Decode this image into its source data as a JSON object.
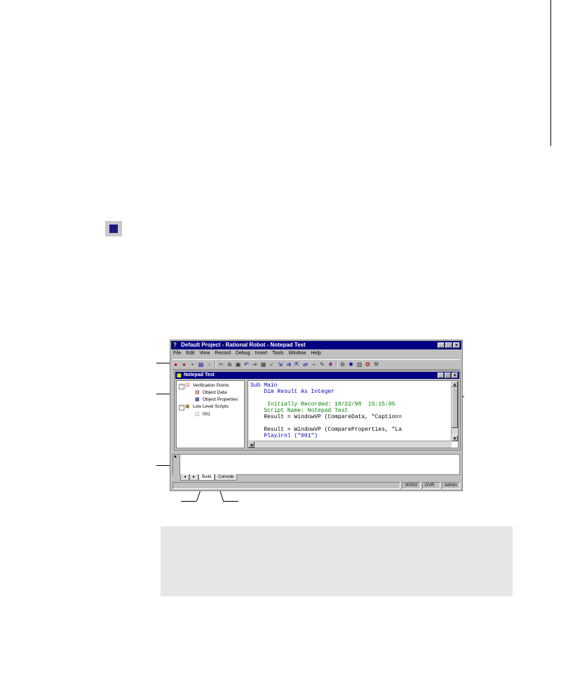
{
  "app": {
    "title": "Default Project - Rational Robot - Notepad Test",
    "window_buttons": [
      "_",
      "□",
      "×"
    ],
    "menu": [
      "File",
      "Edit",
      "View",
      "Record",
      "Debug",
      "Insert",
      "Tools",
      "Window",
      "Help"
    ]
  },
  "script_window": {
    "title": "Notepad Test",
    "buttons": [
      "_",
      "□",
      "×"
    ]
  },
  "tree": {
    "items": [
      {
        "label": "Verification Points",
        "icon": "verification-points-icon"
      },
      {
        "label": "Object Data",
        "icon": "object-data-icon"
      },
      {
        "label": "Object Properties",
        "icon": "object-properties-icon"
      },
      {
        "label": "Low Level Scripts",
        "icon": "low-level-scripts-icon"
      },
      {
        "label": "001",
        "icon": "script-icon"
      }
    ]
  },
  "code": {
    "lines": [
      {
        "text": "Sub Main",
        "kind": "kw"
      },
      {
        "text": "    Dim Result As Integer",
        "kind": "kw"
      },
      {
        "text": "",
        "kind": "plain"
      },
      {
        "text": "     Initially Recorded: 10/22/98  15:15:05",
        "kind": "cm"
      },
      {
        "text": "    Script Name: Notepad Test",
        "kind": "cm"
      },
      {
        "text": "    Result = WindowVP (CompareData, \"Caption=",
        "kind": "plain"
      },
      {
        "text": "",
        "kind": "plain"
      },
      {
        "text": "    Result = WindowVP (CompareProperties, \"La",
        "kind": "plain"
      },
      {
        "text": "    PlayJrnl (\"001\")",
        "kind": "kw"
      }
    ]
  },
  "output": {
    "tabs": [
      "Build",
      "Console"
    ]
  },
  "status": {
    "cells": [
      "00002",
      "OVR",
      "Admin"
    ]
  }
}
